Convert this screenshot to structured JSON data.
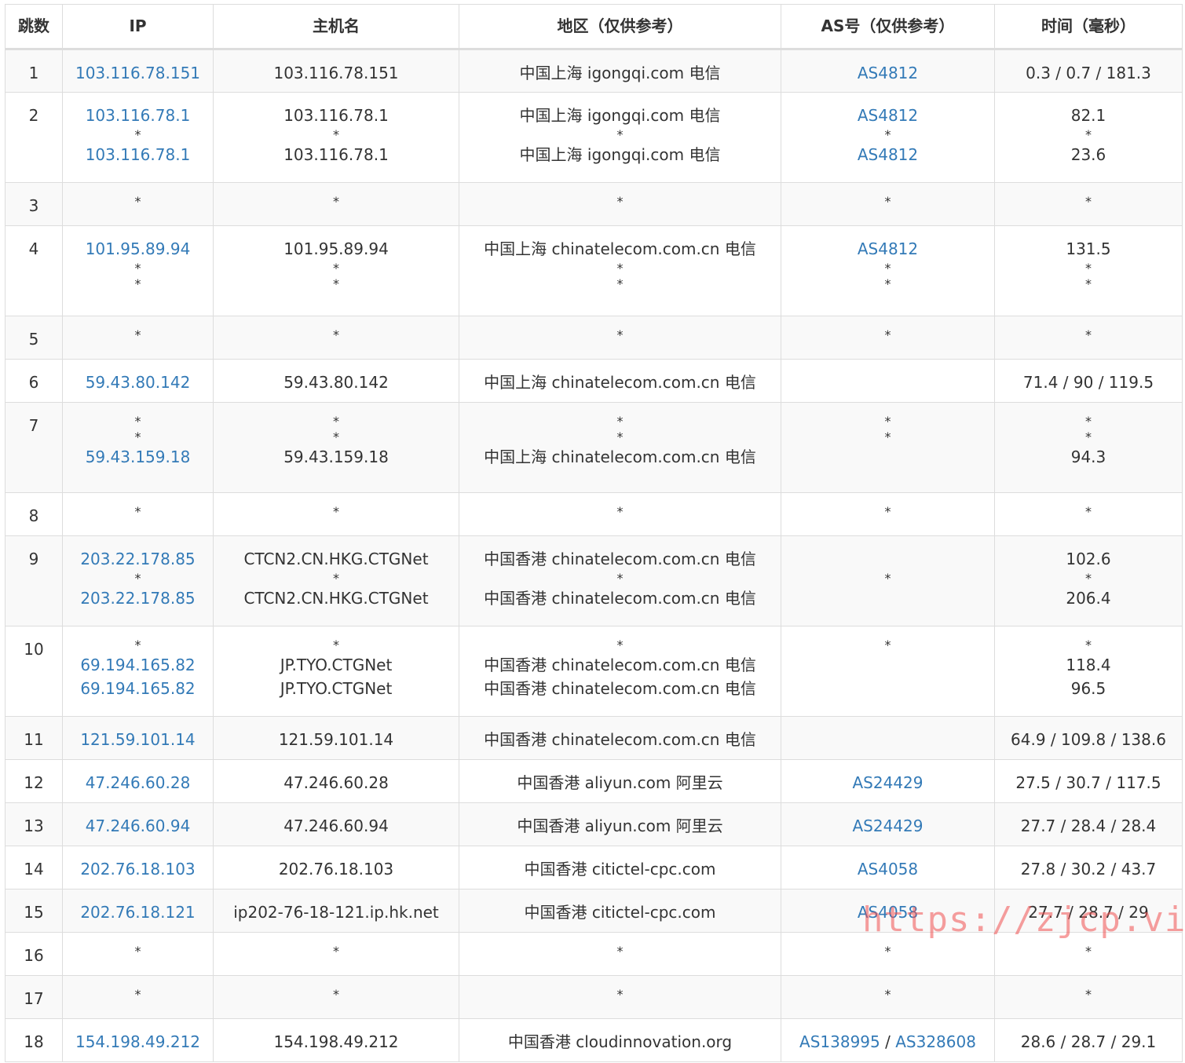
{
  "headers": [
    "跳数",
    "IP",
    "主机名",
    "地区（仅供参考）",
    "AS号（仅供参考）",
    "时间（毫秒）"
  ],
  "rows": [
    {
      "hop": "1",
      "lines": [
        {
          "ip": "103.116.78.151",
          "host": "103.116.78.151",
          "region": "中国上海 igongqi.com 电信",
          "as": [
            "AS4812"
          ],
          "time": "0.3 / 0.7 / 181.3"
        }
      ]
    },
    {
      "hop": "2",
      "lines": [
        {
          "ip": "103.116.78.1",
          "host": "103.116.78.1",
          "region": "中国上海 igongqi.com 电信",
          "as": [
            "AS4812"
          ],
          "time": "82.1"
        },
        {
          "ip": "*",
          "host": "*",
          "region": "*",
          "as": [
            "*"
          ],
          "time": "*"
        },
        {
          "ip": "103.116.78.1",
          "host": "103.116.78.1",
          "region": "中国上海 igongqi.com 电信",
          "as": [
            "AS4812"
          ],
          "time": "23.6"
        }
      ]
    },
    {
      "hop": "3",
      "lines": [
        {
          "ip": "*",
          "host": "*",
          "region": "*",
          "as": [
            "*"
          ],
          "time": "*"
        }
      ]
    },
    {
      "hop": "4",
      "lines": [
        {
          "ip": "101.95.89.94",
          "host": "101.95.89.94",
          "region": "中国上海 chinatelecom.com.cn 电信",
          "as": [
            "AS4812"
          ],
          "time": "131.5"
        },
        {
          "ip": "*",
          "host": "*",
          "region": "*",
          "as": [
            "*"
          ],
          "time": "*"
        },
        {
          "ip": "*",
          "host": "*",
          "region": "*",
          "as": [
            "*"
          ],
          "time": "*"
        }
      ]
    },
    {
      "hop": "5",
      "lines": [
        {
          "ip": "*",
          "host": "*",
          "region": "*",
          "as": [
            "*"
          ],
          "time": "*"
        }
      ]
    },
    {
      "hop": "6",
      "lines": [
        {
          "ip": "59.43.80.142",
          "host": "59.43.80.142",
          "region": "中国上海 chinatelecom.com.cn 电信",
          "as": [],
          "time": "71.4 / 90 / 119.5"
        }
      ]
    },
    {
      "hop": "7",
      "lines": [
        {
          "ip": "*",
          "host": "*",
          "region": "*",
          "as": [
            "*"
          ],
          "time": "*"
        },
        {
          "ip": "*",
          "host": "*",
          "region": "*",
          "as": [
            "*"
          ],
          "time": "*"
        },
        {
          "ip": "59.43.159.18",
          "host": "59.43.159.18",
          "region": "中国上海 chinatelecom.com.cn 电信",
          "as": [],
          "time": "94.3"
        }
      ]
    },
    {
      "hop": "8",
      "lines": [
        {
          "ip": "*",
          "host": "*",
          "region": "*",
          "as": [
            "*"
          ],
          "time": "*"
        }
      ]
    },
    {
      "hop": "9",
      "lines": [
        {
          "ip": "203.22.178.85",
          "host": "CTCN2.CN.HKG.CTGNet",
          "region": "中国香港 chinatelecom.com.cn 电信",
          "as": [],
          "time": "102.6"
        },
        {
          "ip": "*",
          "host": "*",
          "region": "*",
          "as": [
            "*"
          ],
          "time": "*"
        },
        {
          "ip": "203.22.178.85",
          "host": "CTCN2.CN.HKG.CTGNet",
          "region": "中国香港 chinatelecom.com.cn 电信",
          "as": [],
          "time": "206.4"
        }
      ]
    },
    {
      "hop": "10",
      "lines": [
        {
          "ip": "*",
          "host": "*",
          "region": "*",
          "as": [
            "*"
          ],
          "time": "*"
        },
        {
          "ip": "69.194.165.82",
          "host": "JP.TYO.CTGNet",
          "region": "中国香港 chinatelecom.com.cn 电信",
          "as": [],
          "time": "118.4"
        },
        {
          "ip": "69.194.165.82",
          "host": "JP.TYO.CTGNet",
          "region": "中国香港 chinatelecom.com.cn 电信",
          "as": [],
          "time": "96.5"
        }
      ]
    },
    {
      "hop": "11",
      "lines": [
        {
          "ip": "121.59.101.14",
          "host": "121.59.101.14",
          "region": "中国香港 chinatelecom.com.cn 电信",
          "as": [],
          "time": "64.9 / 109.8 / 138.6"
        }
      ]
    },
    {
      "hop": "12",
      "lines": [
        {
          "ip": "47.246.60.28",
          "host": "47.246.60.28",
          "region": "中国香港 aliyun.com 阿里云",
          "as": [
            "AS24429"
          ],
          "time": "27.5 / 30.7 / 117.5"
        }
      ]
    },
    {
      "hop": "13",
      "lines": [
        {
          "ip": "47.246.60.94",
          "host": "47.246.60.94",
          "region": "中国香港 aliyun.com 阿里云",
          "as": [
            "AS24429"
          ],
          "time": "27.7 / 28.4 / 28.4"
        }
      ]
    },
    {
      "hop": "14",
      "lines": [
        {
          "ip": "202.76.18.103",
          "host": "202.76.18.103",
          "region": "中国香港 citictel-cpc.com",
          "as": [
            "AS4058"
          ],
          "time": "27.8 / 30.2 / 43.7"
        }
      ]
    },
    {
      "hop": "15",
      "lines": [
        {
          "ip": "202.76.18.121",
          "host": "ip202-76-18-121.ip.hk.net",
          "region": "中国香港 citictel-cpc.com",
          "as": [
            "AS4058"
          ],
          "time": "27.7 / 28.7 / 29"
        }
      ]
    },
    {
      "hop": "16",
      "lines": [
        {
          "ip": "*",
          "host": "*",
          "region": "*",
          "as": [
            "*"
          ],
          "time": "*"
        }
      ]
    },
    {
      "hop": "17",
      "lines": [
        {
          "ip": "*",
          "host": "*",
          "region": "*",
          "as": [
            "*"
          ],
          "time": "*"
        }
      ]
    },
    {
      "hop": "18",
      "lines": [
        {
          "ip": "154.198.49.212",
          "host": "154.198.49.212",
          "region": "中国香港 cloudinnovation.org",
          "as": [
            "AS138995",
            "AS328608"
          ],
          "time": "28.6 / 28.7 / 29.1"
        }
      ]
    }
  ],
  "as_separator": " / ",
  "watermark": "https://zjcp.vip",
  "colors": {
    "link": "#337ab7",
    "border": "#dddddd",
    "stripe": "#f9f9f9",
    "watermark": "#f05050"
  }
}
